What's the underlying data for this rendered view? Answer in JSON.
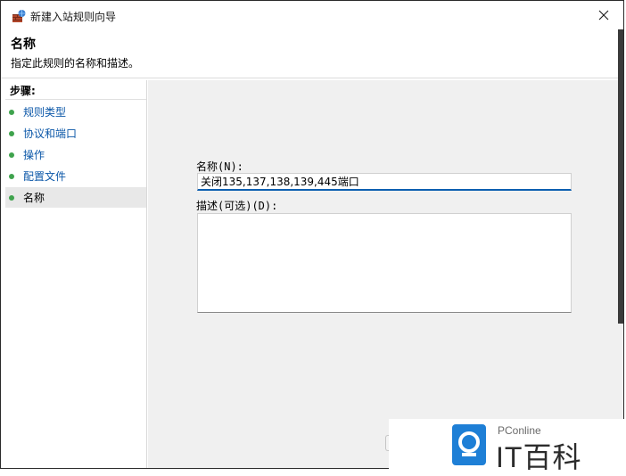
{
  "window": {
    "title": "新建入站规则向导"
  },
  "header": {
    "title": "名称",
    "description": "指定此规则的名称和描述。"
  },
  "sidebar": {
    "steps_label": "步骤:",
    "items": [
      {
        "label": "规则类型"
      },
      {
        "label": "协议和端口"
      },
      {
        "label": "操作"
      },
      {
        "label": "配置文件"
      },
      {
        "label": "名称"
      }
    ]
  },
  "form": {
    "name_label": "名称(N):",
    "name_value": "关闭135,137,138,139,445端口",
    "desc_label": "描述(可选)(D):",
    "desc_value": ""
  },
  "watermark": {
    "brand": "PConline",
    "name": "IT百科"
  },
  "colors": {
    "accent": "#0c5fb0",
    "step_dot": "#3fa34d",
    "link": "#0b57a8",
    "watermark_blue": "#1e7fd6"
  }
}
